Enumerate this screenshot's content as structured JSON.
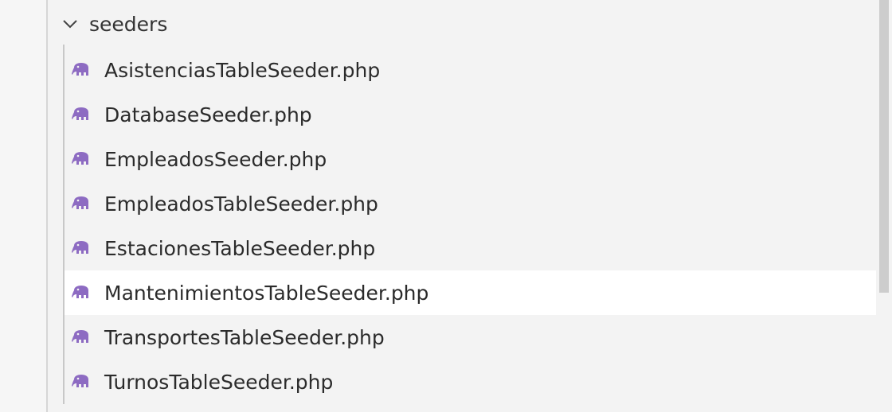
{
  "folder": {
    "name": "seeders",
    "expanded": true
  },
  "colors": {
    "php_icon": "#8d6bc2",
    "selected_row": "#ffffff",
    "background": "#f3f3f3"
  },
  "files": [
    {
      "label": "AsistenciasTableSeeder.php",
      "icon": "php-elephant-icon",
      "selected": false
    },
    {
      "label": "DatabaseSeeder.php",
      "icon": "php-elephant-icon",
      "selected": false
    },
    {
      "label": "EmpleadosSeeder.php",
      "icon": "php-elephant-icon",
      "selected": false
    },
    {
      "label": "EmpleadosTableSeeder.php",
      "icon": "php-elephant-icon",
      "selected": false
    },
    {
      "label": "EstacionesTableSeeder.php",
      "icon": "php-elephant-icon",
      "selected": false
    },
    {
      "label": "MantenimientosTableSeeder.php",
      "icon": "php-elephant-icon",
      "selected": true
    },
    {
      "label": "TransportesTableSeeder.php",
      "icon": "php-elephant-icon",
      "selected": false
    },
    {
      "label": "TurnosTableSeeder.php",
      "icon": "php-elephant-icon",
      "selected": false
    }
  ]
}
